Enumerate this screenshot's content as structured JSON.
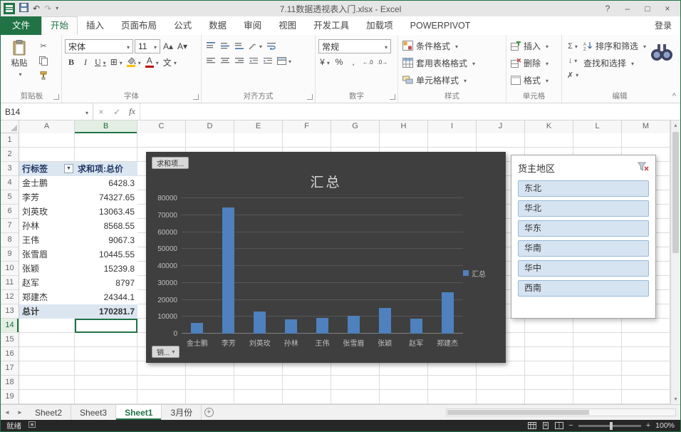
{
  "window": {
    "title": "7.11数据透视表入门.xlsx - Excel",
    "controls": {
      "help": "?",
      "minimize": "–",
      "maximize": "□",
      "close": "×"
    }
  },
  "ribbon": {
    "file_tab": "文件",
    "tabs": [
      "开始",
      "插入",
      "页面布局",
      "公式",
      "数据",
      "审阅",
      "视图",
      "开发工具",
      "加载项",
      "POWERPIVOT"
    ],
    "active_tab": "开始",
    "sign_in": "登录",
    "clipboard": {
      "label": "剪贴板",
      "paste": "粘贴"
    },
    "font": {
      "label": "字体",
      "name": "宋体",
      "size": "11"
    },
    "alignment": {
      "label": "对齐方式"
    },
    "number": {
      "label": "数字",
      "format": "常规"
    },
    "styles": {
      "label": "样式",
      "conditional": "条件格式",
      "table_format": "套用表格格式",
      "cell_styles": "单元格样式"
    },
    "cells": {
      "label": "单元格",
      "insert": "插入",
      "delete": "删除",
      "format": "格式"
    },
    "editing": {
      "label": "编辑",
      "sort_filter": "排序和筛选",
      "find_select": "查找和选择"
    }
  },
  "formula_bar": {
    "name_box": "B14"
  },
  "grid": {
    "columns": [
      "A",
      "B",
      "C",
      "D",
      "E",
      "F",
      "G",
      "H",
      "I",
      "J",
      "K",
      "L",
      "M"
    ],
    "row_numbers": [
      1,
      2,
      3,
      4,
      5,
      6,
      7,
      8,
      9,
      10,
      11,
      12,
      13,
      14,
      15,
      16,
      17,
      18,
      19
    ],
    "selected_cell": "B14",
    "selected_column": "B",
    "selected_row": 14
  },
  "pivot_table": {
    "start_row": 3,
    "header": {
      "row_label": "行标签",
      "value_label": "求和项:总价"
    },
    "rows": [
      {
        "label": "金士鹏",
        "value": "6428.3"
      },
      {
        "label": "李芳",
        "value": "74327.65"
      },
      {
        "label": "刘英玫",
        "value": "13063.45"
      },
      {
        "label": "孙林",
        "value": "8568.55"
      },
      {
        "label": "王伟",
        "value": "9067.3"
      },
      {
        "label": "张雪眉",
        "value": "10445.55"
      },
      {
        "label": "张颖",
        "value": "15239.8"
      },
      {
        "label": "赵军",
        "value": "8797"
      },
      {
        "label": "郑建杰",
        "value": "24344.1"
      }
    ],
    "total": {
      "label": "总计",
      "value": "170281.7"
    }
  },
  "chart_data": {
    "type": "bar",
    "title": "汇总",
    "categories": [
      "金士鹏",
      "李芳",
      "刘英玫",
      "孙林",
      "王伟",
      "张雪眉",
      "张颖",
      "赵军",
      "郑建杰"
    ],
    "values": [
      6428.3,
      74327.65,
      13063.45,
      8568.55,
      9067.3,
      10445.55,
      15239.8,
      8797,
      24344.1
    ],
    "ylim": [
      0,
      80000
    ],
    "yticks": [
      0,
      10000,
      20000,
      30000,
      40000,
      50000,
      60000,
      70000,
      80000
    ],
    "legend": [
      "汇总"
    ],
    "legend_position": "right",
    "grid": true,
    "bar_color": "#4E81BD",
    "background": "#3F3F3F",
    "field_buttons": {
      "value": "求和项...",
      "axis": "销..."
    }
  },
  "slicer": {
    "title": "货主地区",
    "items": [
      "东北",
      "华北",
      "华东",
      "华南",
      "华中",
      "西南"
    ]
  },
  "sheet_tabs": {
    "tabs": [
      "Sheet2",
      "Sheet3",
      "Sheet1",
      "3月份"
    ],
    "active": "Sheet1"
  },
  "status_bar": {
    "ready": "就绪",
    "zoom": "100%"
  },
  "colors": {
    "accent_green": "#217346",
    "chart_background": "#3F3F3F",
    "bar_fill": "#4E81BD",
    "pivot_header_fill": "#DCE6F1",
    "slicer_item_fill": "#D6E4F2",
    "selection_border": "#217346"
  },
  "icons": {
    "undo": "↶",
    "redo": "↷",
    "qat_dropdown": "▾",
    "cancel": "×",
    "enter": "✓",
    "fx": "fx",
    "cut": "✂",
    "bold": "B",
    "italic": "I",
    "underline": "U",
    "borders": "⊞",
    "phonetic": "文",
    "grow_font": "A▴",
    "shrink_font": "A▾",
    "font_color": "A",
    "currency": "¥",
    "percent": "%",
    "comma": ",",
    "inc_decimal": "←.0",
    "dec_decimal": ".0→",
    "sum": "Σ",
    "fill_down": "↓",
    "clear": "✗",
    "filter_dropdown": "▼",
    "left_scroll": "◄",
    "right_scroll": "►",
    "up": "▲",
    "down": "▼",
    "plus": "+",
    "zoom_out": "−",
    "zoom_in": "+",
    "collapse": "^"
  }
}
